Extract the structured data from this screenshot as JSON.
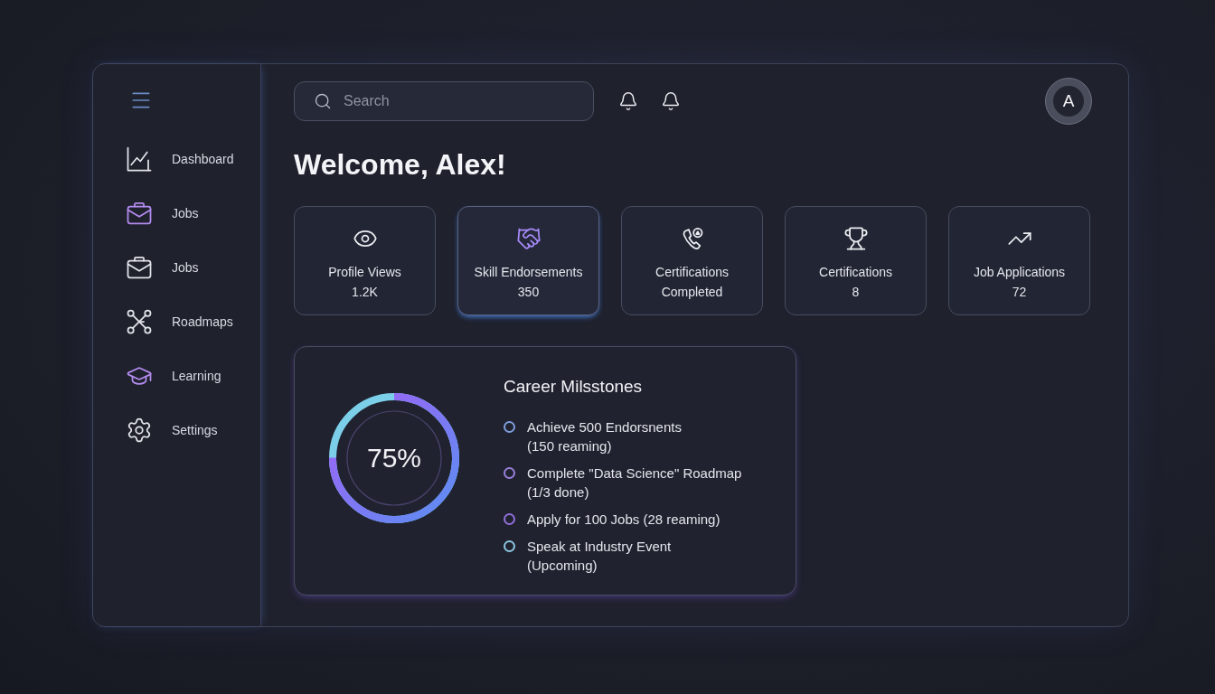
{
  "sidebar": {
    "items": [
      {
        "label": "Dashboard",
        "color": "#e2e4ea"
      },
      {
        "label": "Jobs",
        "color": "#b48cf0"
      },
      {
        "label": "Jobs",
        "color": "#e2e4ea"
      },
      {
        "label": "Roadmaps",
        "color": "#e2e4ea"
      },
      {
        "label": "Learning",
        "color": "#b48cf0"
      },
      {
        "label": "Settings",
        "color": "#e2e4ea"
      }
    ]
  },
  "header": {
    "search": {
      "placeholder": "Search"
    },
    "avatar": {
      "initial": "A"
    }
  },
  "welcome": {
    "title": "Welcome, Alex!"
  },
  "stats": [
    {
      "label": "Profile Views",
      "value": "1.2K",
      "selected": false
    },
    {
      "label": "Skill Endorsements",
      "value": "350",
      "selected": true
    },
    {
      "label": "Certifications",
      "value": "Completed",
      "selected": false
    },
    {
      "label": "Certifications",
      "value": "8",
      "selected": false
    },
    {
      "label": "Job Applications",
      "value": "72",
      "selected": false
    }
  ],
  "milestones": {
    "title": "Career Milsstones",
    "progress": {
      "level": 0.75,
      "reading": "75%"
    },
    "items": [
      {
        "title": "Achieve 500 Endorsnents",
        "detail": "(150 reaming)",
        "color": "#7f9ede"
      },
      {
        "title": "Complete \"Data Science\" Roadmap",
        "detail": "(1/3 done)",
        "color": "#9a80dc"
      },
      {
        "title": "Apply for 100 Jobs (28 reaming)",
        "color": "#9270dc"
      },
      {
        "title": "Speak at Industry Event",
        "detail": "(Upcoming)",
        "color": "#8cc6e2"
      }
    ]
  }
}
